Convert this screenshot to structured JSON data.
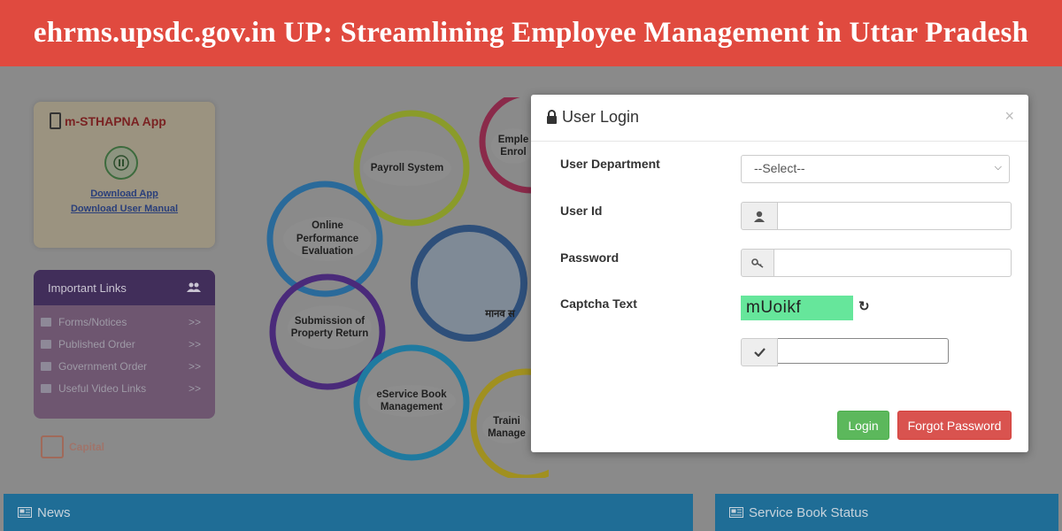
{
  "banner": {
    "title": "ehrms.upsdc.gov.in UP: Streamlining Employee Management in Uttar Pradesh"
  },
  "app_card": {
    "title": "m-STHAPNA App",
    "download_app": "Download App",
    "download_manual": "Download User Manual"
  },
  "important_links": {
    "title": "Important Links",
    "items": [
      {
        "label": "Forms/Notices",
        "arrow": ">>"
      },
      {
        "label": "Published Order",
        "arrow": ">>"
      },
      {
        "label": "Government Order",
        "arrow": ">>"
      },
      {
        "label": "Useful Video Links",
        "arrow": ">>"
      }
    ]
  },
  "capital_logo": {
    "text": "Capital"
  },
  "bubbles": {
    "payroll": "Payroll System",
    "enrolment": "Emple Enrol",
    "performance": "Online Performance Evaluation",
    "property": "Submission of Property Return",
    "eservice": "eService Book Management",
    "training": "Traini Manage",
    "center": "मानव स"
  },
  "bottom": {
    "news": "News",
    "service_book": "Service Book Status"
  },
  "login": {
    "title": "User Login",
    "close": "×",
    "fields": {
      "department": {
        "label": "User Department",
        "value": "--Select--"
      },
      "user_id": {
        "label": "User Id",
        "value": ""
      },
      "password": {
        "label": "Password",
        "value": ""
      },
      "captcha": {
        "label": "Captcha Text",
        "code": "mUoikf",
        "value": ""
      }
    },
    "login_button": "Login",
    "forgot_button": "Forgot Password"
  },
  "colors": {
    "banner": "#e04a3f",
    "login_button": "#5cb85c",
    "forgot_button": "#d9534f",
    "captcha_bg": "#66e69b",
    "bottom_bar": "#1f6d96"
  },
  "icons": [
    "lock-icon",
    "close-icon",
    "user-icon",
    "key-icon",
    "refresh-icon",
    "check-icon",
    "chevron-down-icon",
    "phone-icon",
    "users-icon",
    "newspaper-icon"
  ]
}
